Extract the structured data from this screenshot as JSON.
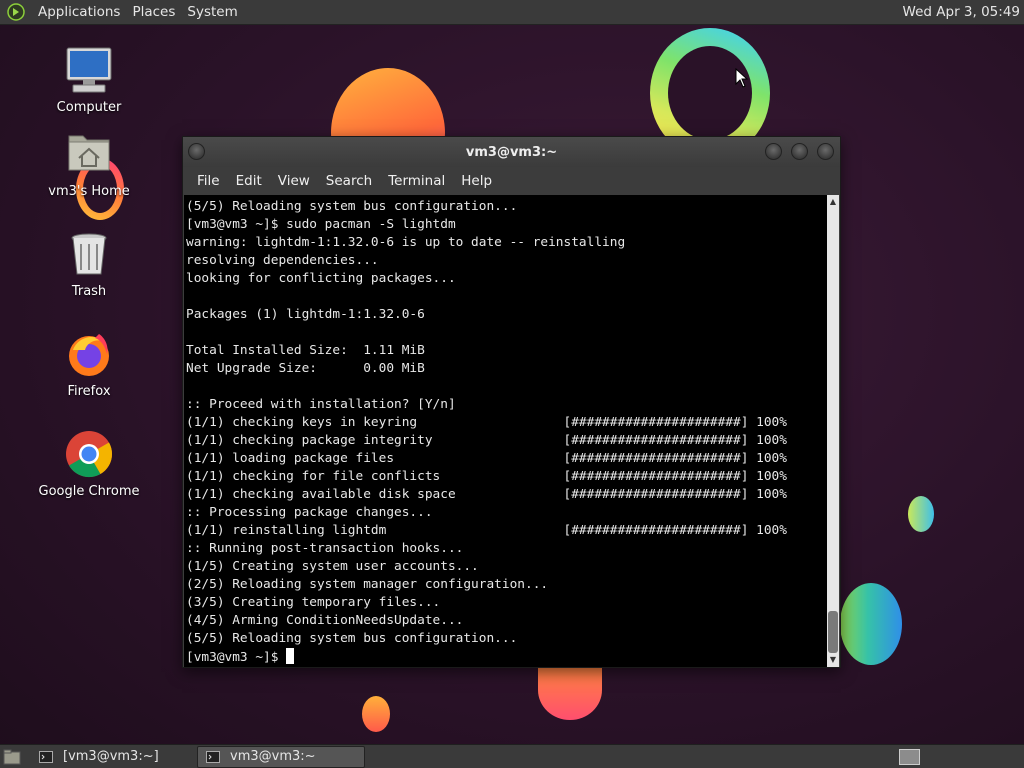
{
  "top_panel": {
    "menu_applications": "Applications",
    "menu_places": "Places",
    "menu_system": "System",
    "clock": "Wed Apr 3, 05:49"
  },
  "desktop": {
    "icons": [
      {
        "label": "Computer",
        "icon": "computer-icon"
      },
      {
        "label": "vm3's Home",
        "icon": "home-folder-icon"
      },
      {
        "label": "Trash",
        "icon": "trash-icon"
      },
      {
        "label": "Firefox",
        "icon": "firefox-icon"
      },
      {
        "label": "Google Chrome",
        "icon": "chrome-icon"
      }
    ]
  },
  "terminal": {
    "title": "vm3@vm3:~",
    "menu": [
      "File",
      "Edit",
      "View",
      "Search",
      "Terminal",
      "Help"
    ],
    "lines": [
      "(5/5) Reloading system bus configuration...",
      "[vm3@vm3 ~]$ sudo pacman -S lightdm",
      "warning: lightdm-1:1.32.0-6 is up to date -- reinstalling",
      "resolving dependencies...",
      "looking for conflicting packages...",
      "",
      "Packages (1) lightdm-1:1.32.0-6",
      "",
      "Total Installed Size:  1.11 MiB",
      "Net Upgrade Size:      0.00 MiB",
      "",
      ":: Proceed with installation? [Y/n]",
      "(1/1) checking keys in keyring                   [######################] 100%",
      "(1/1) checking package integrity                 [######################] 100%",
      "(1/1) loading package files                      [######################] 100%",
      "(1/1) checking for file conflicts                [######################] 100%",
      "(1/1) checking available disk space              [######################] 100%",
      ":: Processing package changes...",
      "(1/1) reinstalling lightdm                       [######################] 100%",
      ":: Running post-transaction hooks...",
      "(1/5) Creating system user accounts...",
      "(2/5) Reloading system manager configuration...",
      "(3/5) Creating temporary files...",
      "(4/5) Arming ConditionNeedsUpdate...",
      "(5/5) Reloading system bus configuration..."
    ],
    "prompt": "[vm3@vm3 ~]$ "
  },
  "taskbar": {
    "tasks": [
      {
        "label": "[vm3@vm3:~]",
        "active": false
      },
      {
        "label": "vm3@vm3:~",
        "active": true
      }
    ]
  },
  "colors": {
    "panel": "#3a3a3a",
    "terminal_bg": "#000000",
    "terminal_fg": "#e8e8e8",
    "desktop_bg": "#2a1326"
  }
}
